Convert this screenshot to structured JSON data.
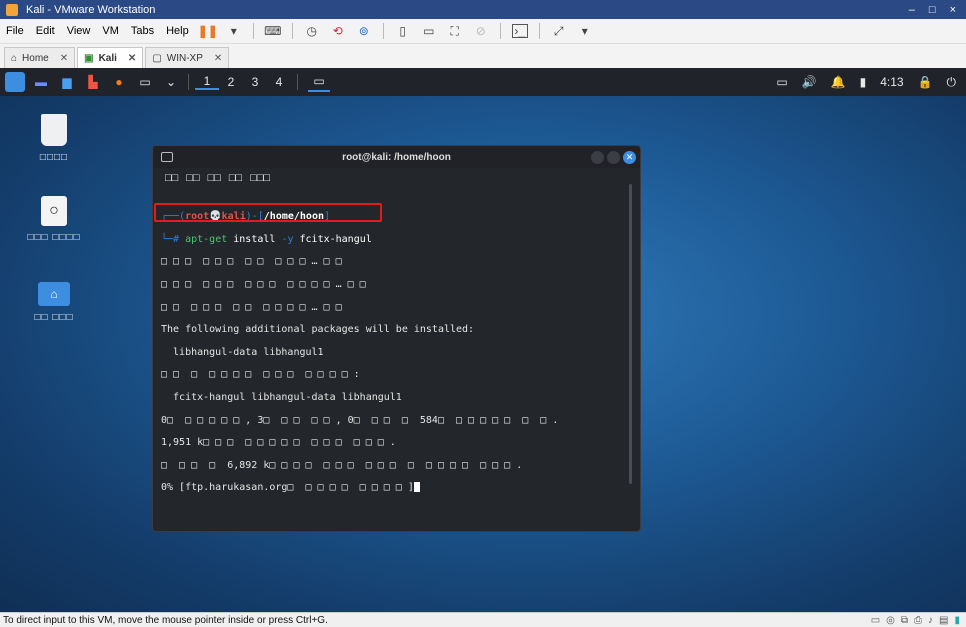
{
  "window": {
    "title": "Kali - VMware Workstation",
    "controls": [
      "–",
      "□",
      "×"
    ]
  },
  "menu": {
    "items": [
      "File",
      "Edit",
      "View",
      "VM",
      "Tabs",
      "Help"
    ]
  },
  "tabs": [
    {
      "label": "Home",
      "icon": "home-icon"
    },
    {
      "label": "Kali",
      "icon": "vm-icon"
    },
    {
      "label": "WIN-XP",
      "icon": "vm-icon"
    }
  ],
  "panel": {
    "workspaces": [
      "1",
      "2",
      "3",
      "4"
    ],
    "time": "4:13"
  },
  "desktop": {
    "icons": [
      {
        "label": "□□□□",
        "icon": "trash-icon"
      },
      {
        "label": "□□□ □□□□",
        "icon": "drive-icon"
      },
      {
        "label": "□□ □□□",
        "icon": "home-folder-icon"
      }
    ]
  },
  "terminal": {
    "title": "root@kali: /home/hoon",
    "menu": [
      "□□",
      "□□",
      "□□",
      "□□",
      "□□□"
    ],
    "prompt_prefix": "┌──(",
    "prompt_user": "root💀kali",
    "prompt_mid": ")-[",
    "prompt_path": "/home/hoon",
    "prompt_end": "]",
    "cmd_prefix": "└─# ",
    "cmd_name": "apt-get",
    "cmd_args1": " install ",
    "cmd_flag": "-y",
    "cmd_args2": " fcitx-hangul",
    "lines": [
      "□ □ □  □ □ □  □ □  □ □ □ … □ □",
      "□ □ □  □ □ □  □ □ □  □ □ □ □ … □ □",
      "□ □  □ □ □  □ □  □ □ □ □ … □ □",
      "The following additional packages will be installed:",
      "  libhangul-data libhangul1",
      "□ □  □  □ □ □ □  □ □ □  □ □ □ □ :",
      "  fcitx-hangul libhangul-data libhangul1",
      "0□  □ □ □ □ □ , 3□  □ □  □ □ , 0□  □ □  □  584□  □ □ □ □ □  □  □ .",
      "1,951 k□ □ □  □ □ □ □ □  □ □ □  □ □ □ .",
      "□  □ □  □  6,892 k□ □ □ □  □ □ □  □ □ □  □  □ □ □ □  □ □ □ .",
      "0% [ftp.harukasan.org□  □ □ □ □  □ □ □ □ ]"
    ]
  },
  "statusbar": {
    "text": "To direct input to this VM, move the mouse pointer inside or press Ctrl+G."
  }
}
